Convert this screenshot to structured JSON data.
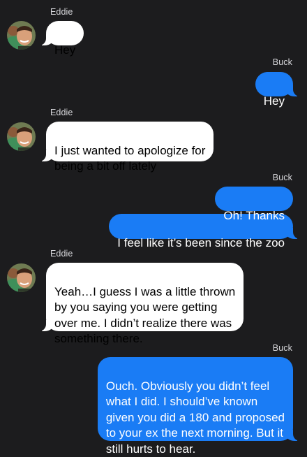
{
  "conversation": {
    "contact_name": "Eddie",
    "user_name": "Buck",
    "groups": [
      {
        "sender": "Eddie",
        "messages": [
          "Hey"
        ]
      },
      {
        "sender": "Buck",
        "messages": [
          "Hey"
        ]
      },
      {
        "sender": "Eddie",
        "messages": [
          "I just wanted to apologize for\nbeing a bit off lately"
        ]
      },
      {
        "sender": "Buck",
        "messages": [
          "Oh! Thanks",
          "I feel like it’s been since the zoo"
        ]
      },
      {
        "sender": "Eddie",
        "messages": [
          "Yeah…I guess I was a little thrown\nby you saying you were getting\nover me. I didn’t realize there was\nsomething there."
        ]
      },
      {
        "sender": "Buck",
        "messages": [
          "Ouch. Obviously you didn’t feel\nwhat I did. I should’ve known\ngiven you did a 180 and proposed\nto your ex the next morning. But it\nstill hurts to hear."
        ]
      }
    ]
  },
  "colors": {
    "background": "#1c1c1e",
    "incoming_bubble": "#ffffff",
    "outgoing_bubble": "#1a7cf5",
    "name_label": "#d8d8dc"
  },
  "icons": {
    "avatar": "contact-photo-icon"
  }
}
